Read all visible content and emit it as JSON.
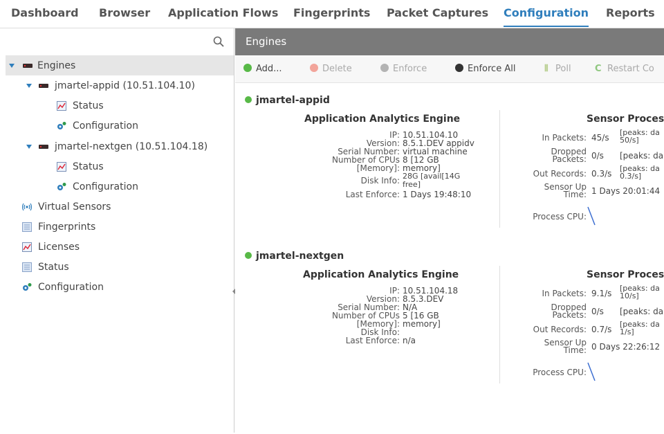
{
  "nav": {
    "tabs": [
      "Dashboard",
      "Browser",
      "Application Flows",
      "Fingerprints",
      "Packet Captures",
      "Configuration",
      "Reports"
    ],
    "active_tab": "Configuration"
  },
  "tree": {
    "engines": "Engines",
    "appid": "jmartel-appid (10.51.104.10)",
    "appid_status": "Status",
    "appid_config": "Configuration",
    "nextgen": "jmartel-nextgen (10.51.104.18)",
    "nextgen_status": "Status",
    "nextgen_config": "Configuration",
    "virtual_sensors": "Virtual Sensors",
    "fingerprints": "Fingerprints",
    "licenses": "Licenses",
    "status": "Status",
    "configuration": "Configuration"
  },
  "panel": {
    "title": "Engines"
  },
  "toolbar": {
    "add": "Add...",
    "delete": "Delete",
    "enforce": "Enforce",
    "enforce_all": "Enforce All",
    "poll": "Poll",
    "restart": "Restart Co"
  },
  "engines": [
    {
      "name": "jmartel-appid",
      "app_title": "Application Analytics Engine",
      "labels": {
        "ip": "IP:",
        "version": "Version:",
        "serial": "Serial Number:",
        "cpus": "Number of CPUs",
        "memory": "[Memory]:",
        "disk": "Disk Info:",
        "last_enforce": "Last Enforce:"
      },
      "ip": "10.51.104.10",
      "version": "8.5.1.DEV appidv",
      "serial": "virtual machine",
      "cpus_line1": "8 [12 GB",
      "cpus_line2": "memory]",
      "disk_line1": "28G [avail[14G",
      "disk_line2": "free]",
      "last_enforce": "1 Days 19:48:10",
      "sensor_title": "Sensor Proces",
      "sensor_labels": {
        "in_packets": "In Packets:",
        "dropped_1": "Dropped",
        "dropped_2": "Packets:",
        "out_records": "Out Records:",
        "uptime_1": "Sensor Up",
        "uptime_2": "Time:",
        "cpu": "Process CPU:"
      },
      "in_packets": "45/s",
      "in_peak_1": "[peaks: da",
      "in_peak_2": "50/s]",
      "dropped": "0/s",
      "dropped_peak": "[peaks: da",
      "out_records": "0.3/s",
      "out_peak_1": "[peaks: da",
      "out_peak_2": "0.3/s]",
      "uptime": "1 Days 20:01:44"
    },
    {
      "name": "jmartel-nextgen",
      "app_title": "Application Analytics Engine",
      "labels": {
        "ip": "IP:",
        "version": "Version:",
        "serial": "Serial Number:",
        "cpus": "Number of CPUs",
        "memory": "[Memory]:",
        "disk": "Disk Info:",
        "last_enforce": "Last Enforce:"
      },
      "ip": "10.51.104.18",
      "version": "8.5.3.DEV",
      "serial": "N/A",
      "cpus_line1": "5 [16 GB",
      "cpus_line2": "memory]",
      "disk_line1": "",
      "disk_line2": "",
      "last_enforce": "n/a",
      "sensor_title": "Sensor Proces",
      "sensor_labels": {
        "in_packets": "In Packets:",
        "dropped_1": "Dropped",
        "dropped_2": "Packets:",
        "out_records": "Out Records:",
        "uptime_1": "Sensor Up",
        "uptime_2": "Time:",
        "cpu": "Process CPU:"
      },
      "in_packets": "9.1/s",
      "in_peak_1": "[peaks: da",
      "in_peak_2": "10/s]",
      "dropped": "0/s",
      "dropped_peak": "[peaks: da",
      "out_records": "0.7/s",
      "out_peak_1": "[peaks: da",
      "out_peak_2": "1/s]",
      "uptime": "0 Days 22:26:12"
    }
  ],
  "colors": {
    "accent": "#2f7ebc",
    "status_ok": "#58b947",
    "header_bg": "#7a7a7a"
  }
}
